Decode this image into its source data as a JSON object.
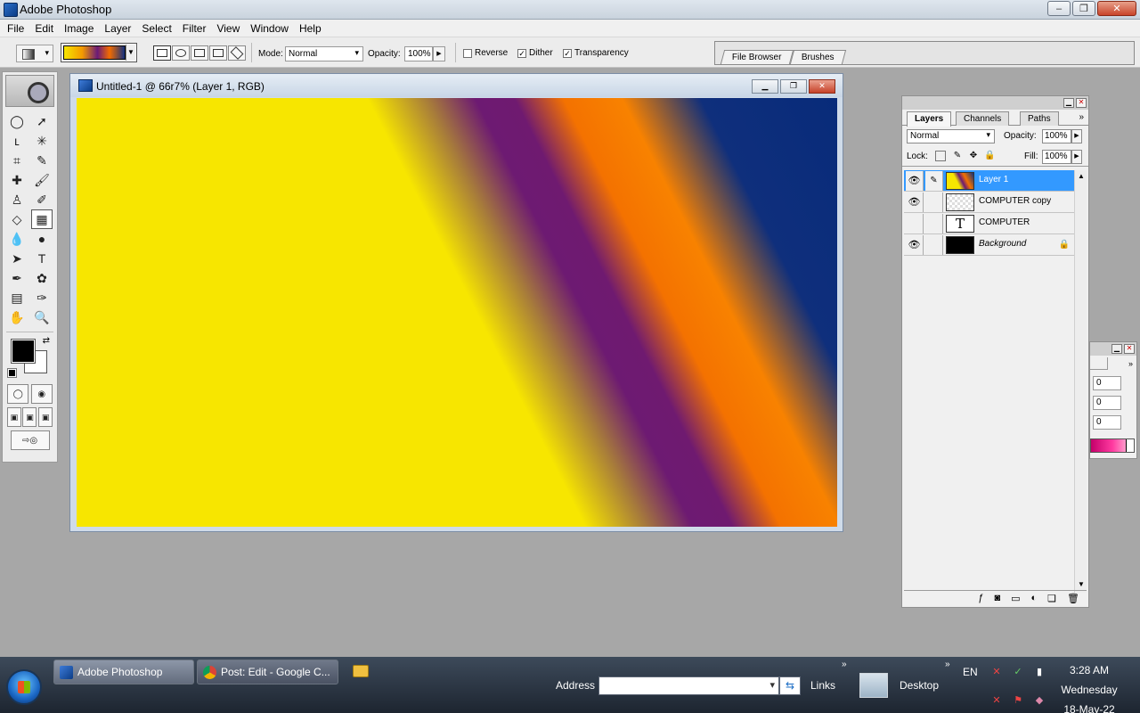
{
  "app": {
    "title": "Adobe Photoshop"
  },
  "window_controls": {
    "minimize": "–",
    "restore": "❐",
    "close": "✕"
  },
  "menu": [
    "File",
    "Edit",
    "Image",
    "Layer",
    "Select",
    "Filter",
    "View",
    "Window",
    "Help"
  ],
  "options_bar": {
    "mode_label": "Mode:",
    "mode_value": "Normal",
    "opacity_label": "Opacity:",
    "opacity_value": "100%",
    "reverse_label": "Reverse",
    "reverse_checked": false,
    "dither_label": "Dither",
    "dither_checked": true,
    "transparency_label": "Transparency",
    "transparency_checked": true,
    "well_tabs": [
      "File Browser",
      "Brushes"
    ]
  },
  "document": {
    "title": "Untitled-1 @ 66r7% (Layer 1, RGB)",
    "gradient_colors": [
      "#f7e600",
      "#6d1a72",
      "#f47200",
      "#0f2f7c"
    ]
  },
  "toolbox": {
    "icons": [
      "marquee-icon",
      "move-icon",
      "lasso-icon",
      "magic-wand-icon",
      "crop-icon",
      "slice-icon",
      "healing-brush-icon",
      "brush-icon",
      "clone-stamp-icon",
      "history-brush-icon",
      "eraser-icon",
      "gradient-icon",
      "blur-icon",
      "dodge-icon",
      "path-select-icon",
      "type-icon",
      "pen-icon",
      "custom-shape-icon",
      "notes-icon",
      "eyedropper-icon",
      "hand-icon",
      "zoom-icon"
    ],
    "glyphs": [
      "◯",
      "➚",
      "ʟ",
      "✳",
      "⌗",
      "✎",
      "✚",
      "🖌",
      "♙",
      "✐",
      "◇",
      "▦",
      "💧",
      "●",
      "➤",
      "T",
      "✒",
      "✿",
      "▤",
      "✑",
      "✋",
      "🔍"
    ],
    "foreground_color": "#000000",
    "background_color": "#ffffff"
  },
  "layers_panel": {
    "tabs": [
      "Layers",
      "Channels",
      "Paths"
    ],
    "blend_mode": "Normal",
    "opacity_label": "Opacity:",
    "opacity_value": "100%",
    "lock_label": "Lock:",
    "fill_label": "Fill:",
    "fill_value": "100%",
    "layers": [
      {
        "name": "Layer 1",
        "visible": true,
        "selected": true,
        "thumb": "gradient"
      },
      {
        "name": "COMPUTER copy",
        "visible": true,
        "selected": false,
        "thumb": "transparent"
      },
      {
        "name": "COMPUTER",
        "visible": false,
        "selected": false,
        "thumb": "text"
      },
      {
        "name": "Background",
        "visible": true,
        "selected": false,
        "thumb": "black",
        "locked": true
      }
    ]
  },
  "color_panel": {
    "values": [
      "0",
      "0",
      "0"
    ]
  },
  "taskbar": {
    "buttons": [
      "Adobe Photoshop",
      "Post: Edit - Google C..."
    ],
    "address_label": "Address",
    "address_value": "",
    "links_label": "Links",
    "desktop_label": "Desktop",
    "chevron": "»",
    "language": "EN",
    "clock_time": "3:28 AM",
    "clock_day": "Wednesday",
    "clock_date": "18-May-22"
  }
}
